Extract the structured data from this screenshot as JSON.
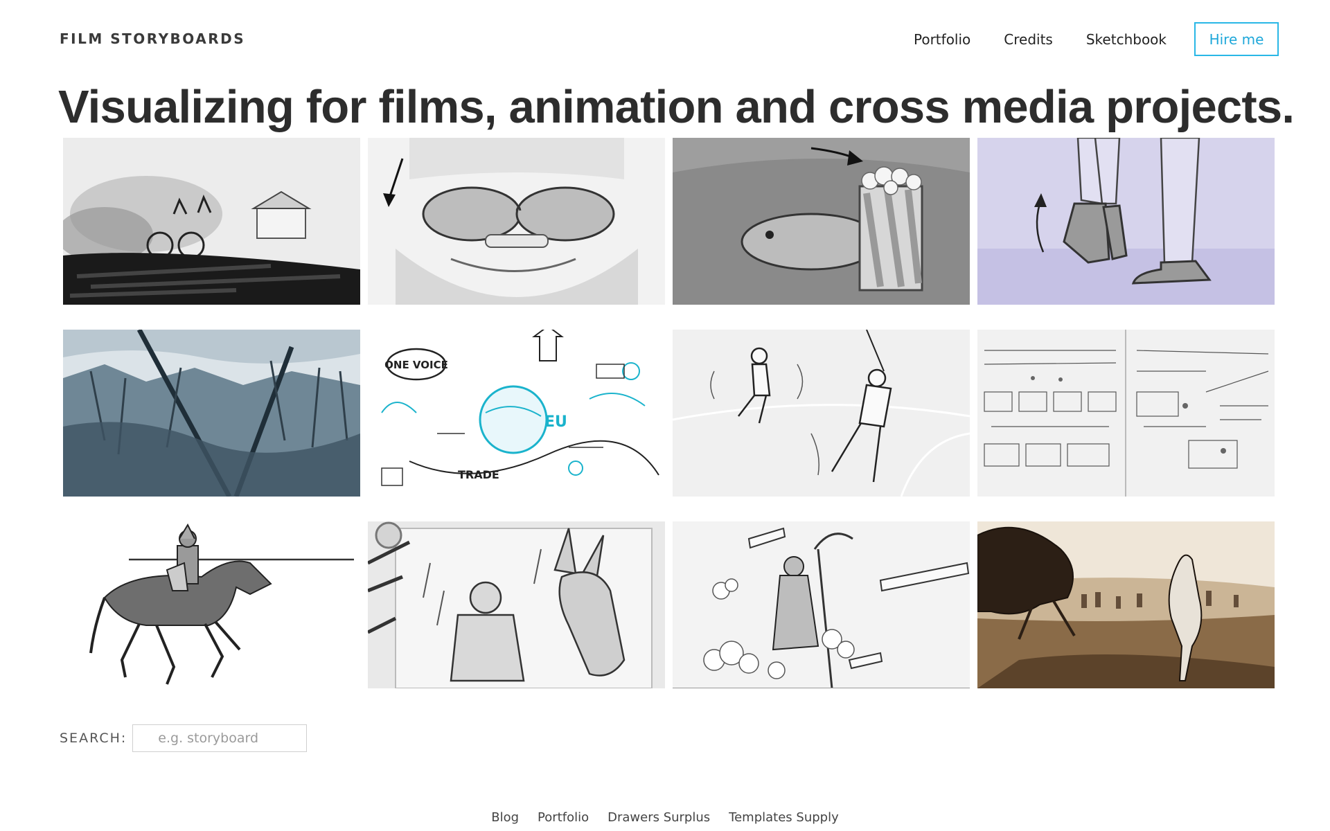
{
  "header": {
    "brand": "FILM STORYBOARDS",
    "nav": [
      "Portfolio",
      "Credits",
      "Sketchbook"
    ],
    "cta": "Hire me"
  },
  "headline": "Visualizing for films, animation and cross media projects.",
  "gallery": {
    "illustration_texts": {
      "one_voice": "ONE VOICE",
      "eu": "EU",
      "trade": "TRADE"
    }
  },
  "search": {
    "label": "SEARCH:",
    "placeholder": "e.g. storyboard",
    "value": ""
  },
  "footer": {
    "links": [
      "Blog",
      "Portfolio",
      "Drawers Surplus",
      "Templates Supply"
    ]
  },
  "colors": {
    "accent": "#29b7e6",
    "text": "#2b2b2b",
    "background": "#ffffff"
  }
}
